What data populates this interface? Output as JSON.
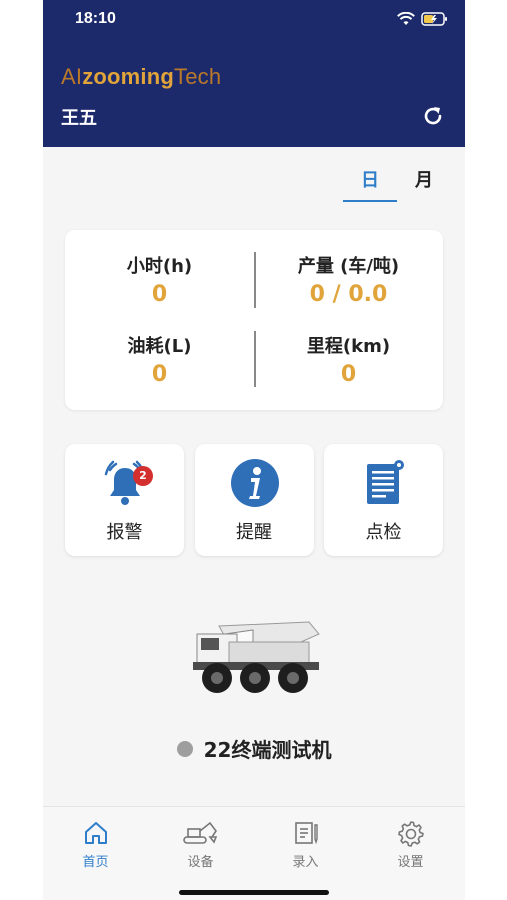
{
  "status_bar": {
    "time": "18:10"
  },
  "header": {
    "logo_prefix": "AI",
    "logo_mid": "zooming",
    "logo_suffix": "Tech",
    "user_name": "王五"
  },
  "tabs": [
    {
      "label": "日",
      "active": true
    },
    {
      "label": "月",
      "active": false
    }
  ],
  "stats": {
    "hours": {
      "label": "小时(h)",
      "value": "0"
    },
    "production": {
      "label": "产量 (车/吨)",
      "value": "0 / 0.0"
    },
    "fuel": {
      "label": "油耗(L)",
      "value": "0"
    },
    "mileage": {
      "label": "里程(km)",
      "value": "0"
    }
  },
  "actions": [
    {
      "label": "报警",
      "icon": "alarm-bell-icon",
      "badge": "2"
    },
    {
      "label": "提醒",
      "icon": "info-icon"
    },
    {
      "label": "点检",
      "icon": "checklist-icon"
    }
  ],
  "device": {
    "name": "22终端测试机",
    "status_color": "#9e9e9e"
  },
  "bottom_nav": [
    {
      "label": "首页",
      "icon": "home-icon",
      "active": true
    },
    {
      "label": "设备",
      "icon": "excavator-icon",
      "active": false
    },
    {
      "label": "录入",
      "icon": "entry-icon",
      "active": false
    },
    {
      "label": "设置",
      "icon": "gear-icon",
      "active": false
    }
  ],
  "colors": {
    "header_bg": "#1c2a6b",
    "accent": "#2f7ec9",
    "value": "#e0a43a",
    "badge": "#d32f2f"
  }
}
